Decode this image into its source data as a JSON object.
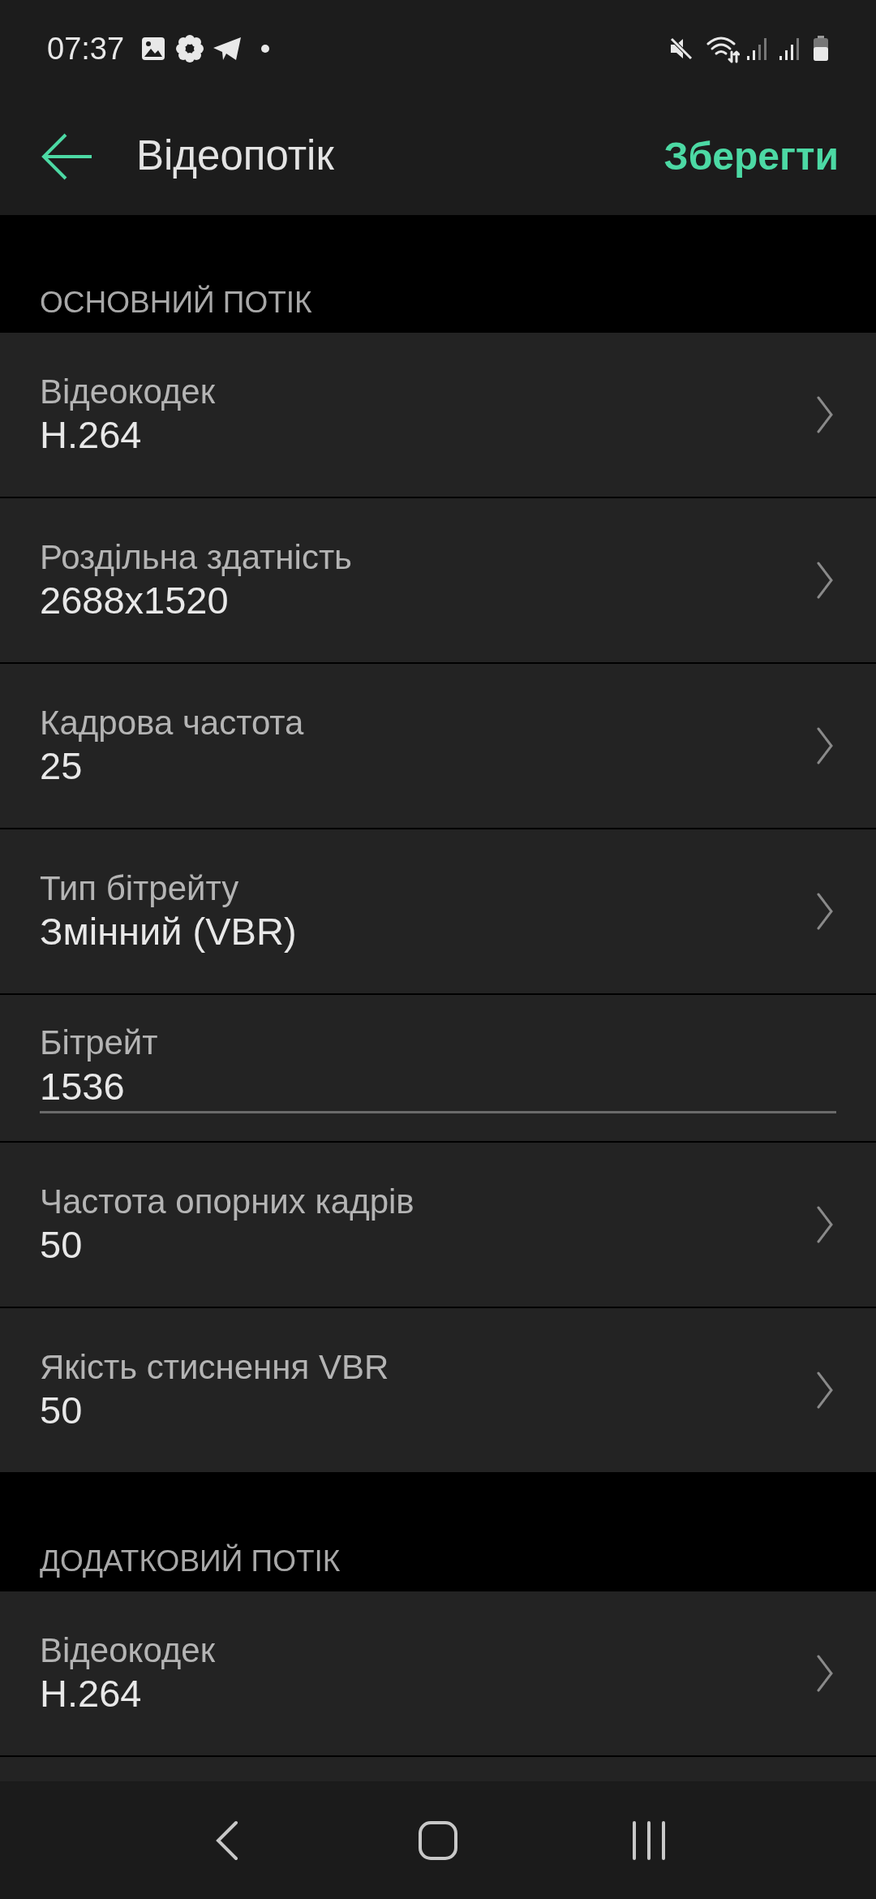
{
  "status_bar": {
    "time": "07:37"
  },
  "app_bar": {
    "title": "Відеопотік",
    "action": "Зберегти"
  },
  "sections": [
    {
      "header": "ОСНОВНИЙ ПОТІК",
      "rows": [
        {
          "kind": "chevron",
          "label": "Відеокодек",
          "value": "H.264"
        },
        {
          "kind": "chevron",
          "label": "Роздільна здатність",
          "value": "2688x1520"
        },
        {
          "kind": "chevron",
          "label": "Кадрова частота",
          "value": "25"
        },
        {
          "kind": "chevron",
          "label": "Тип бітрейту",
          "value": "Змінний (VBR)"
        },
        {
          "kind": "input",
          "label": "Бітрейт",
          "value": "1536"
        },
        {
          "kind": "chevron",
          "label": "Частота опорних кадрів",
          "value": "50"
        },
        {
          "kind": "chevron",
          "label": "Якість стиснення VBR",
          "value": "50"
        }
      ]
    },
    {
      "header": "ДОДАТКОВИЙ ПОТІК",
      "rows": [
        {
          "kind": "chevron",
          "label": "Відеокодек",
          "value": "H.264"
        }
      ]
    }
  ]
}
